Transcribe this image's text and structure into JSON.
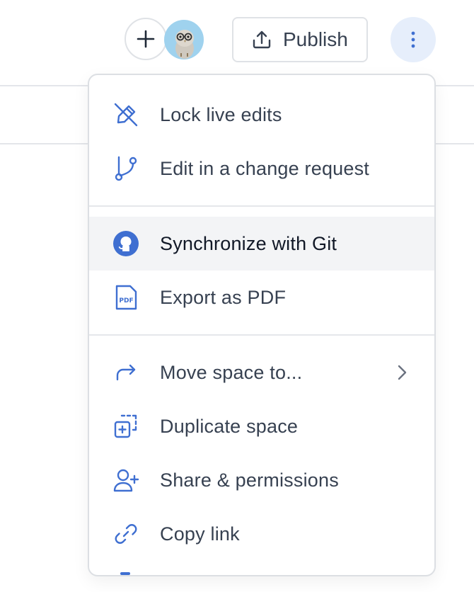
{
  "toolbar": {
    "add_icon": "plus-icon",
    "publish_label": "Publish",
    "publish_icon": "upload-icon",
    "more_icon": "vertical-dots-icon"
  },
  "colors": {
    "accent": "#3f6fd1",
    "hover_bg": "#f3f4f6",
    "more_bg": "#e6eefb"
  },
  "menu": {
    "groups": [
      [
        {
          "label": "Lock live edits",
          "icon": "pencil-off-icon"
        },
        {
          "label": "Edit in a change request",
          "icon": "git-branch-icon"
        }
      ],
      [
        {
          "label": "Synchronize with Git",
          "icon": "github-icon",
          "hovered": true
        },
        {
          "label": "Export as PDF",
          "icon": "pdf-file-icon"
        }
      ],
      [
        {
          "label": "Move space to...",
          "icon": "arrow-turn-right-icon",
          "submenu": true
        },
        {
          "label": "Duplicate space",
          "icon": "duplicate-icon"
        },
        {
          "label": "Share & permissions",
          "icon": "user-plus-icon"
        },
        {
          "label": "Copy link",
          "icon": "link-icon"
        }
      ]
    ]
  }
}
